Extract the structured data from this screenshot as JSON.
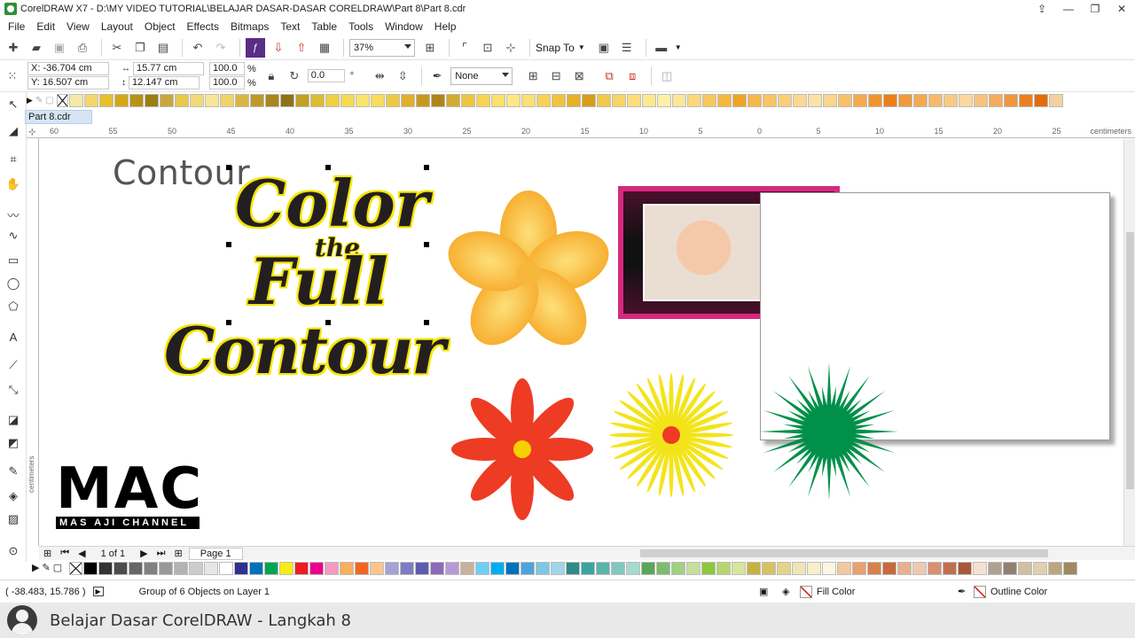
{
  "window": {
    "title": "CorelDRAW X7 - D:\\MY VIDEO TUTORIAL\\BELAJAR DASAR-DASAR CORELDRAW\\Part 8\\Part 8.cdr",
    "buttons": [
      "⇪",
      "—",
      "❐",
      "✕"
    ]
  },
  "menu": [
    "File",
    "Edit",
    "View",
    "Layout",
    "Object",
    "Effects",
    "Bitmaps",
    "Text",
    "Table",
    "Tools",
    "Window",
    "Help"
  ],
  "toolbar": {
    "zoom": "37%",
    "snap_to": "Snap To"
  },
  "propbar": {
    "x": "X: -36.704 cm",
    "y": "Y: 16.507 cm",
    "width": "15.77 cm",
    "height": "12.147 cm",
    "scale_x": "100.0",
    "scale_y": "100.0",
    "pct": "%",
    "rotation": "0.0",
    "degree": "°",
    "outline": "None"
  },
  "doc_tab": "Part 8.cdr",
  "ruler": {
    "h_ticks": [
      "60",
      "55",
      "50",
      "45",
      "40",
      "35",
      "30",
      "25",
      "20",
      "15",
      "10",
      "5",
      "0",
      "5",
      "10",
      "15",
      "20",
      "25"
    ],
    "unit": "centimeters",
    "v_unit": "centimeters"
  },
  "canvas": {
    "heading": "Contour",
    "art_line1": "Color",
    "art_line2": "the",
    "art_line3": "Full",
    "art_line4": "Contour",
    "logo_big": "MAC",
    "logo_small": "MAS AJI CHANNEL"
  },
  "pagebar": {
    "page_of": "1 of 1",
    "page_tab": "Page 1"
  },
  "status": {
    "coords": "( -38.483, 15.786 )",
    "selection": "Group of 6 Objects on Layer 1",
    "fill": "Fill Color",
    "outline": "Outline Color"
  },
  "caption": "Belajar Dasar CorelDRAW - Langkah 8",
  "colors": {
    "frame_pink": "#d6297f",
    "flower_red": "#ee3b24",
    "sunburst_yellow": "#f3e41a",
    "starburst_green": "#00904a",
    "text_outline_yellow": "#f6e500"
  }
}
